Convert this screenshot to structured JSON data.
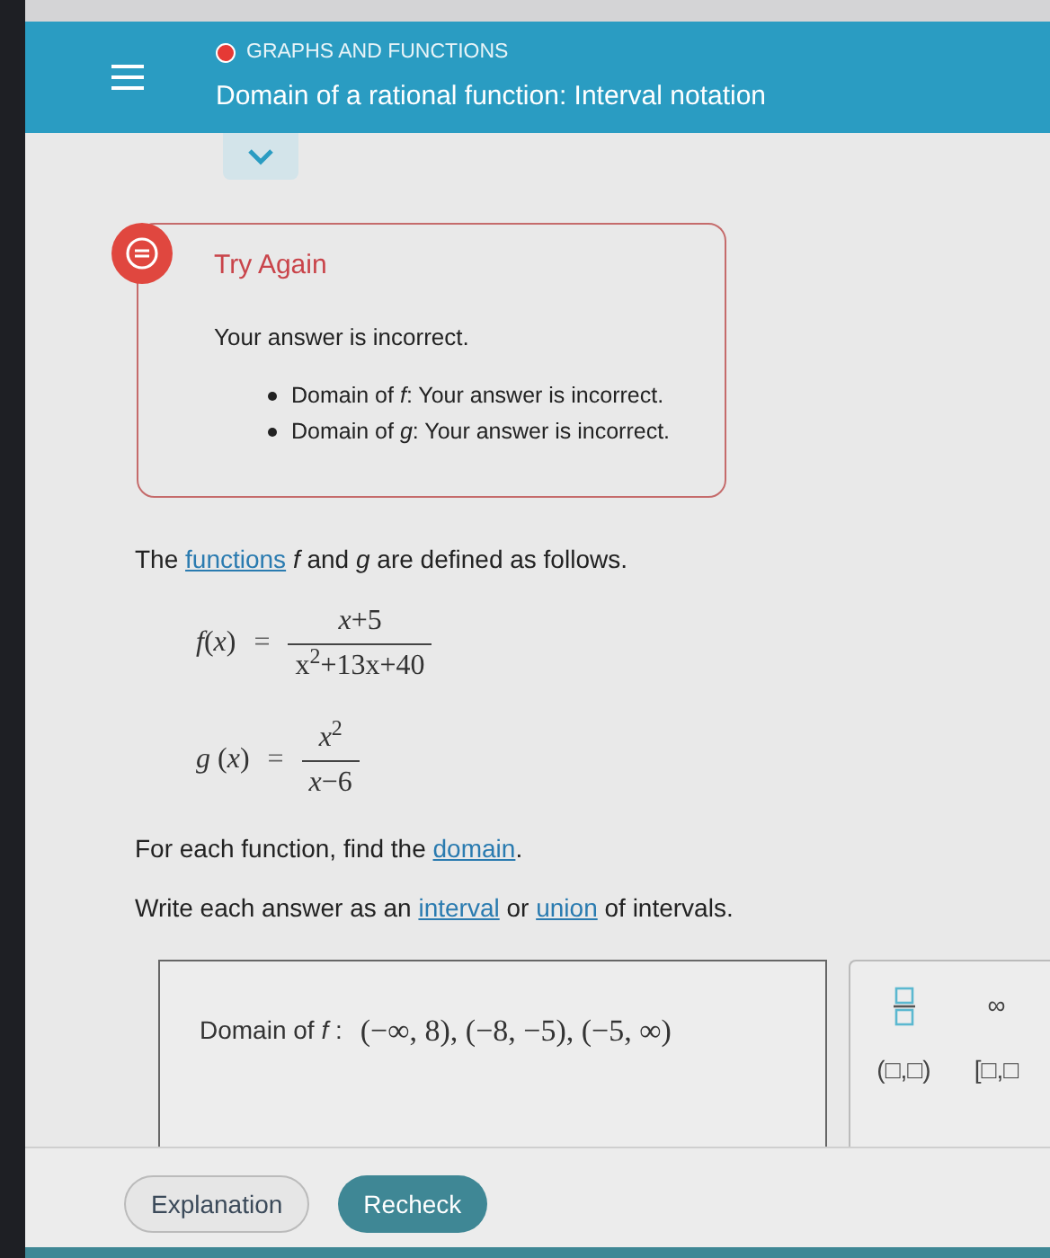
{
  "header": {
    "category": "GRAPHS AND FUNCTIONS",
    "title": "Domain of a rational function: Interval notation"
  },
  "feedback": {
    "title": "Try Again",
    "message": "Your answer is incorrect.",
    "items": [
      "Domain of *f*: Your answer is incorrect.",
      "Domain of *g*: Your answer is incorrect."
    ]
  },
  "problem": {
    "intro": [
      {
        "kind": "text",
        "text": "The "
      },
      {
        "kind": "link",
        "text": "functions"
      },
      {
        "kind": "text",
        "text": " *f* and *g* are defined as follows."
      }
    ],
    "equations": [
      {
        "lhs": "*f*(*x*)",
        "eq": "=",
        "numerator": "*x*+5",
        "denominator": "x$^{2}$+13x+40"
      },
      {
        "lhs": "*g* (*x*)",
        "eq": "=",
        "numerator": "*x*$^{2}$",
        "denominator": "*x*−6"
      }
    ],
    "instructions": [
      [
        {
          "kind": "text",
          "text": "For each function, find the "
        },
        {
          "kind": "link",
          "text": "domain"
        },
        {
          "kind": "text",
          "text": "."
        }
      ],
      [
        {
          "kind": "text",
          "text": "Write each answer as an "
        },
        {
          "kind": "link",
          "text": "interval"
        },
        {
          "kind": "text",
          "text": " or "
        },
        {
          "kind": "link",
          "text": "union"
        },
        {
          "kind": "text",
          "text": " of intervals."
        }
      ]
    ]
  },
  "answer": {
    "label": "Domain of *f* :",
    "value": "(−∞, 8), (−8, −5), (−5, ∞)"
  },
  "keypad": [
    {
      "kind": "fraction"
    },
    {
      "kind": "text",
      "label": "∞"
    },
    {
      "kind": "text",
      "label": "(□,□)"
    },
    {
      "kind": "text",
      "label": "[□,□"
    }
  ],
  "buttons": [
    {
      "label": "Explanation",
      "primary": false
    },
    {
      "label": "Recheck",
      "primary": true
    }
  ]
}
